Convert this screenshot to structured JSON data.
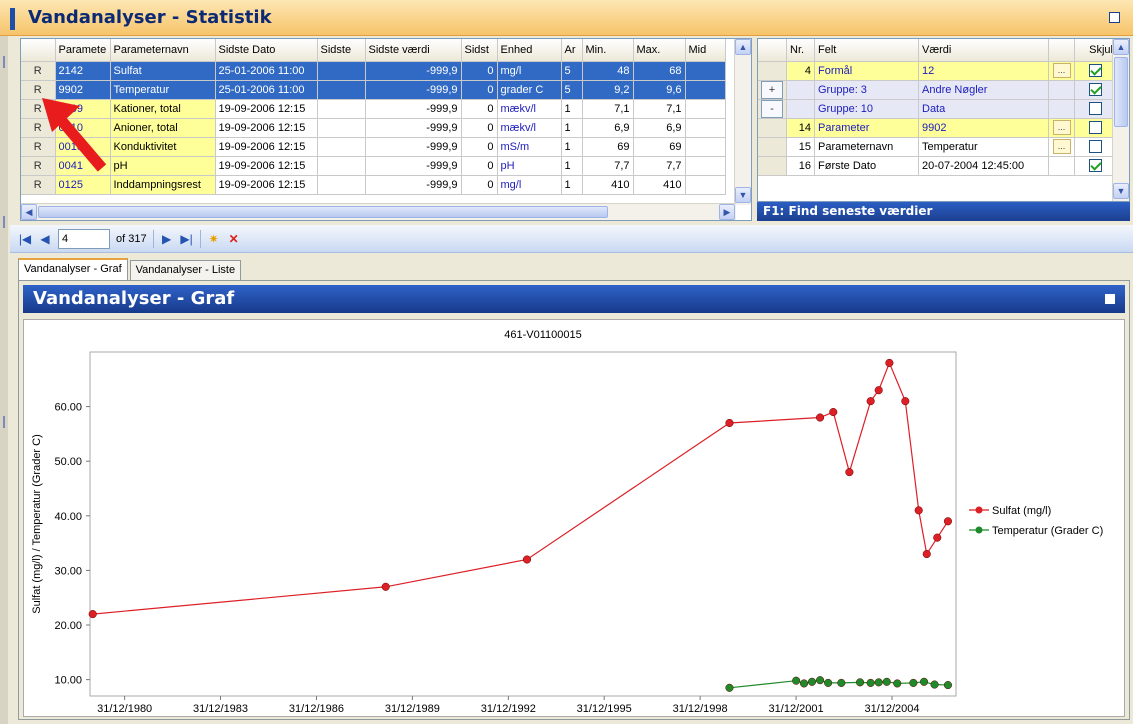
{
  "title": "Vandanalyser - Statistik",
  "main_grid": {
    "headers": [
      "Paramete",
      "Parameternavn",
      "Sidste Dato",
      "Sidste",
      "Sidste værdi",
      "Sidst",
      "Enhed",
      "Ar",
      "Min.",
      "Max.",
      "Mid"
    ],
    "rows": [
      {
        "rowhdr": "R",
        "code": "2142",
        "name": "Sulfat",
        "date": "25-01-2006 11:00",
        "s1": "",
        "value": "-999,9",
        "s2": "0",
        "unit": "mg/l",
        "ar": "5",
        "min": "48",
        "max": "68",
        "mid": ""
      },
      {
        "rowhdr": "R",
        "code": "9902",
        "name": "Temperatur",
        "date": "25-01-2006 11:00",
        "s1": "",
        "value": "-999,9",
        "s2": "0",
        "unit": "grader C",
        "ar": "5",
        "min": "9,2",
        "max": "9,6",
        "mid": ""
      },
      {
        "rowhdr": "R",
        "code": "0009",
        "name": "Kationer, total",
        "date": "19-09-2006 12:15",
        "s1": "",
        "value": "-999,9",
        "s2": "0",
        "unit": "mækv/l",
        "ar": "1",
        "min": "7,1",
        "max": "7,1",
        "mid": ""
      },
      {
        "rowhdr": "R",
        "code": "0010",
        "name": "Anioner, total",
        "date": "19-09-2006 12:15",
        "s1": "",
        "value": "-999,9",
        "s2": "0",
        "unit": "mækv/l",
        "ar": "1",
        "min": "6,9",
        "max": "6,9",
        "mid": ""
      },
      {
        "rowhdr": "R",
        "code": "0015",
        "name": "Konduktivitet",
        "date": "19-09-2006 12:15",
        "s1": "",
        "value": "-999,9",
        "s2": "0",
        "unit": "mS/m",
        "ar": "1",
        "min": "69",
        "max": "69",
        "mid": ""
      },
      {
        "rowhdr": "R",
        "code": "0041",
        "name": "pH",
        "date": "19-09-2006 12:15",
        "s1": "",
        "value": "-999,9",
        "s2": "0",
        "unit": "pH",
        "ar": "1",
        "min": "7,7",
        "max": "7,7",
        "mid": ""
      },
      {
        "rowhdr": "R",
        "code": "0125",
        "name": "Inddampningsrest",
        "date": "19-09-2006 12:15",
        "s1": "",
        "value": "-999,9",
        "s2": "0",
        "unit": "mg/l",
        "ar": "1",
        "min": "410",
        "max": "410",
        "mid": ""
      }
    ]
  },
  "field_grid": {
    "headers": [
      "Nr.",
      "Felt",
      "Værdi",
      "Skjul"
    ],
    "rows": [
      {
        "pm": "",
        "nr": "4",
        "felt": "Formål",
        "vaerdi": "12",
        "ell": "...",
        "checked": true,
        "style": "yellow"
      },
      {
        "pm": "+",
        "nr": "",
        "felt": "Gruppe: 3",
        "vaerdi": "Andre Nøgler",
        "ell": "",
        "checked": true,
        "style": "group"
      },
      {
        "pm": "-",
        "nr": "",
        "felt": "Gruppe: 10",
        "vaerdi": "Data",
        "ell": "",
        "checked": false,
        "style": "group"
      },
      {
        "pm": "",
        "nr": "14",
        "felt": "Parameter",
        "vaerdi": "9902",
        "ell": "...",
        "checked": false,
        "style": "yellow"
      },
      {
        "pm": "",
        "nr": "15",
        "felt": "Parameternavn",
        "vaerdi": "Temperatur",
        "ell": "...",
        "checked": false,
        "style": "plain"
      },
      {
        "pm": "",
        "nr": "16",
        "felt": "Første Dato",
        "vaerdi": "20-07-2004 12:45:00",
        "ell": "",
        "checked": true,
        "style": "plain"
      }
    ]
  },
  "f1_hint": "F1: Find seneste værdier",
  "navigator": {
    "position": "4",
    "of_label": "of 317"
  },
  "tabs": [
    "Vandanalyser - Graf",
    "Vandanalyser - Liste"
  ],
  "graph_panel_title": "Vandanalyser - Graf",
  "colors": {
    "sulfat": "#dd1f26",
    "temperatur": "#1f8a2a",
    "selected_row": "#316ac5",
    "highlight_yellow": "#ffff99"
  },
  "chart_data": {
    "type": "line",
    "title": "461-V01100015",
    "ylabel": "Sulfat (mg/l) / Temperatur (Grader C)",
    "ylim": [
      7,
      70
    ],
    "xlim": [
      "1979-12-01",
      "2007-01-01"
    ],
    "x_ticks": [
      "31/12/1980",
      "31/12/1983",
      "31/12/1986",
      "31/12/1989",
      "31/12/1992",
      "31/12/1995",
      "31/12/1998",
      "31/12/2001",
      "31/12/2004"
    ],
    "y_ticks": [
      "10.00",
      "20.00",
      "30.00",
      "40.00",
      "50.00",
      "60.00"
    ],
    "legend_position": "right",
    "series": [
      {
        "name": "Sulfat (mg/l)",
        "color": "#dd1f26",
        "x": [
          "1980-01-01",
          "1989-03-01",
          "1993-08-01",
          "1999-12-01",
          "2002-10-01",
          "2003-03-01",
          "2003-09-01",
          "2004-05-01",
          "2004-08-01",
          "2004-12-01",
          "2005-06-01",
          "2005-11-01",
          "2006-02-01",
          "2006-06-01",
          "2006-10-01"
        ],
        "values": [
          22,
          27,
          32,
          57,
          58,
          59,
          48,
          61,
          63,
          68,
          61,
          41,
          33,
          36,
          39
        ]
      },
      {
        "name": "Temperatur (Grader C)",
        "color": "#1f8a2a",
        "x": [
          "1999-12-01",
          "2002-01-01",
          "2002-04-01",
          "2002-07-01",
          "2002-10-01",
          "2003-01-01",
          "2003-06-01",
          "2004-01-01",
          "2004-05-01",
          "2004-08-01",
          "2004-11-01",
          "2005-03-01",
          "2005-09-01",
          "2006-01-01",
          "2006-05-01",
          "2006-10-01"
        ],
        "values": [
          8.5,
          9.8,
          9.3,
          9.6,
          9.9,
          9.4,
          9.4,
          9.5,
          9.4,
          9.5,
          9.6,
          9.3,
          9.4,
          9.6,
          9.1,
          9.0
        ]
      }
    ]
  }
}
